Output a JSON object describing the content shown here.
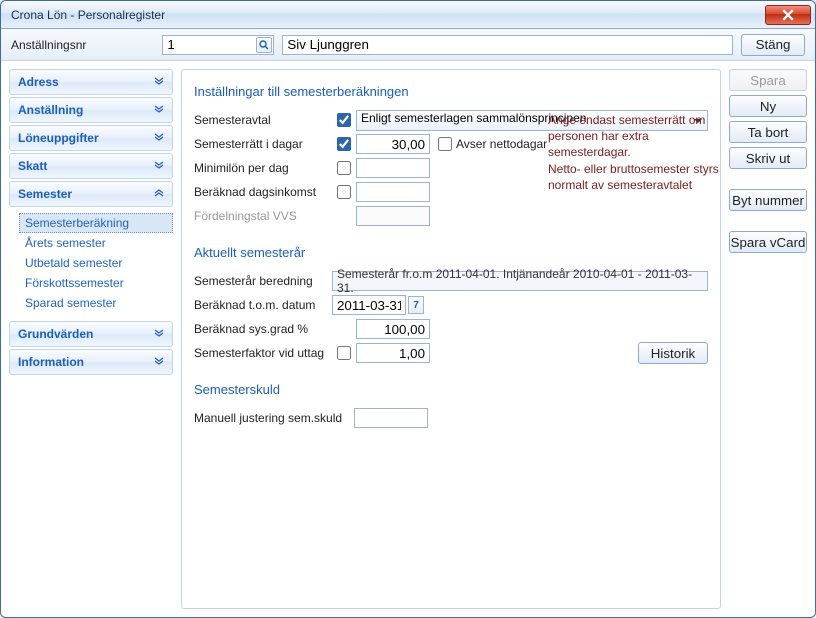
{
  "window": {
    "title": "Crona Lön - Personalregister"
  },
  "toolbar": {
    "emp_no_label": "Anställningsnr",
    "emp_no_value": "1",
    "emp_name_value": "Siv Ljunggren",
    "close_label": "Stäng"
  },
  "sidebar": {
    "items": [
      {
        "label": "Adress",
        "expanded": false
      },
      {
        "label": "Anställning",
        "expanded": false
      },
      {
        "label": "Löneuppgifter",
        "expanded": false
      },
      {
        "label": "Skatt",
        "expanded": false
      },
      {
        "label": "Semester",
        "expanded": true,
        "sub": [
          {
            "label": "Semesterberäkning",
            "selected": true
          },
          {
            "label": "Årets semester"
          },
          {
            "label": "Utbetald semester"
          },
          {
            "label": "Förskottssemester"
          },
          {
            "label": "Sparad semester"
          }
        ]
      },
      {
        "label": "Grundvärden",
        "expanded": false
      },
      {
        "label": "Information",
        "expanded": false
      }
    ]
  },
  "main": {
    "section1_title": "Inställningar till semesterberäkningen",
    "semesteravtal_label": "Semesteravtal",
    "semesteravtal_value": "Enligt semesterlagen sammalönsprincipen",
    "semesterratt_label": "Semesterrätt i dagar",
    "semesterratt_value": "30,00",
    "avser_netto_label": "Avser nettodagar",
    "minimilon_label": "Minimilön per dag",
    "beraknad_dag_label": "Beräknad dagsinkomst",
    "fordelningstal_label": "Fördelningstal VVS",
    "info_text_l1": "Ange endast semesterrätt om",
    "info_text_l2": "personen har extra semesterdagar.",
    "info_text_l3": "Netto- eller bruttosemester styrs",
    "info_text_l4": "normalt av semesteravtalet",
    "section2_title": "Aktuellt semesterår",
    "semar_beredning_label": "Semesterår beredning",
    "semar_beredning_value": "Semesterår fr.o.m 2011-04-01. Intjänandeår 2010-04-01 - 2011-03-31.",
    "beraknad_tom_label": "Beräknad t.o.m. datum",
    "beraknad_tom_value": "2011-03-31",
    "beraknad_sys_label": "Beräknad sys.grad %",
    "beraknad_sys_value": "100,00",
    "semfaktor_label": "Semesterfaktor vid uttag",
    "semfaktor_value": "1,00",
    "historik_label": "Historik",
    "section3_title": "Semesterskuld",
    "manuell_label": "Manuell justering sem.skuld"
  },
  "actions": {
    "spara": "Spara",
    "ny": "Ny",
    "ta_bort": "Ta bort",
    "skriv_ut": "Skriv ut",
    "byt_nummer": "Byt nummer",
    "spara_vcard": "Spara vCard"
  }
}
